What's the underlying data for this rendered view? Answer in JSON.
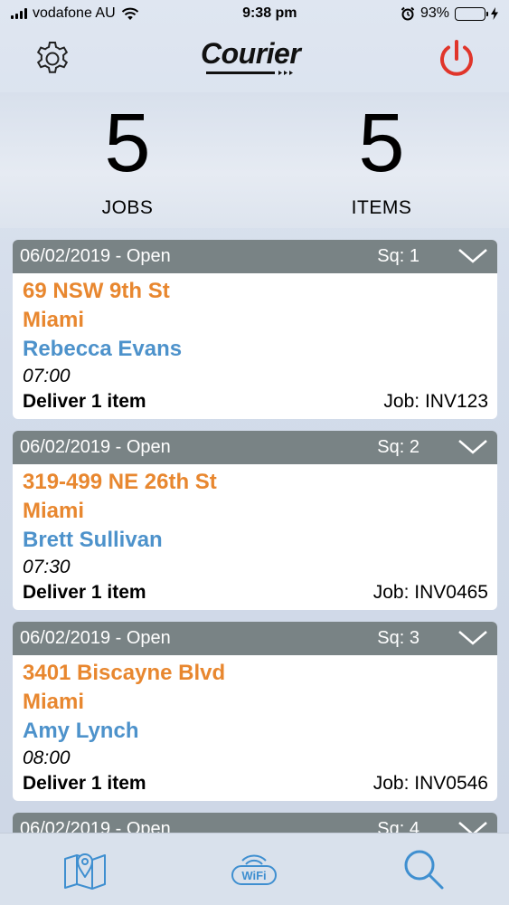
{
  "status": {
    "carrier": "vodafone AU",
    "time": "9:38 pm",
    "battery": "93%",
    "battery_level": 0.93
  },
  "header": {
    "logo_text": "Courier",
    "icons": {
      "settings": "gear-icon",
      "power": "power-icon"
    },
    "colors": {
      "power": "#e0352b"
    }
  },
  "summary": {
    "jobs_value": "5",
    "jobs_label": "JOBS",
    "items_value": "5",
    "items_label": "ITEMS"
  },
  "jobs": [
    {
      "date_status": "06/02/2019 - Open",
      "sq": "Sq: 1",
      "address": "69 NSW 9th St",
      "city": "Miami",
      "name": "Rebecca Evans",
      "time": "07:00",
      "deliver": "Deliver 1 item",
      "job_no": "Job: INV123"
    },
    {
      "date_status": "06/02/2019 - Open",
      "sq": "Sq: 2",
      "address": "319-499 NE 26th St",
      "city": "Miami",
      "name": "Brett Sullivan",
      "time": "07:30",
      "deliver": "Deliver 1 item",
      "job_no": "Job: INV0465"
    },
    {
      "date_status": "06/02/2019 - Open",
      "sq": "Sq: 3",
      "address": "3401 Biscayne Blvd",
      "city": "Miami",
      "name": "Amy Lynch",
      "time": "08:00",
      "deliver": "Deliver 1 item",
      "job_no": "Job: INV0546"
    },
    {
      "date_status": "06/02/2019 - Open",
      "sq": "Sq: 4"
    }
  ],
  "colors": {
    "address": "#e8872f",
    "name": "#4d92cb",
    "card_header": "#798385",
    "tab_icon": "#3f8fd0"
  },
  "tabbar": {
    "icons": [
      "map-icon",
      "wifi-icon",
      "search-icon"
    ],
    "wifi_text": "WiFi"
  }
}
